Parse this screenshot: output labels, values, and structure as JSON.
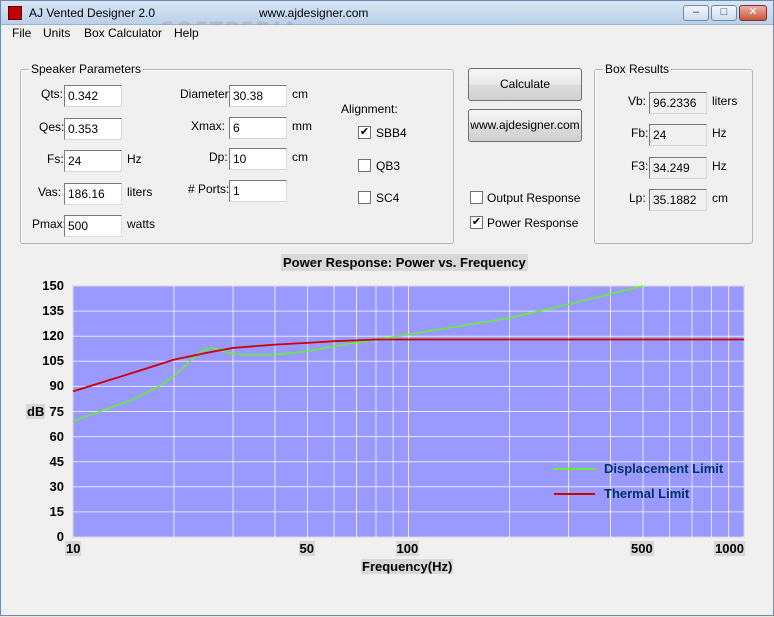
{
  "window": {
    "title": "AJ Vented Designer 2.0",
    "url": "www.ajdesigner.com",
    "watermark": "SOFTPEDIA",
    "controls": {
      "minimize": "–",
      "maximize": "□",
      "close": "✕"
    }
  },
  "menu": [
    "File",
    "Units",
    "Box Calculator",
    "Help"
  ],
  "speaker": {
    "legend": "Speaker Parameters",
    "qts": {
      "label": "Qts:",
      "value": "0.342"
    },
    "qes": {
      "label": "Qes:",
      "value": "0.353"
    },
    "fs": {
      "label": "Fs:",
      "value": "24",
      "unit": "Hz"
    },
    "vas": {
      "label": "Vas:",
      "value": "186.16",
      "unit": "liters"
    },
    "pmax": {
      "label": "Pmax:",
      "value": "500",
      "unit": "watts"
    },
    "diameter": {
      "label": "Diameter:",
      "value": "30.38",
      "unit": "cm"
    },
    "xmax": {
      "label": "Xmax:",
      "value": "6",
      "unit": "mm"
    },
    "dp": {
      "label": "Dp:",
      "value": "10",
      "unit": "cm"
    },
    "ports": {
      "label": "# Ports:",
      "value": "1"
    },
    "alignment": {
      "label": "Alignment:",
      "options": [
        {
          "label": "SBB4",
          "checked": true,
          "mark": "✔"
        },
        {
          "label": "QB3",
          "checked": false,
          "mark": ""
        },
        {
          "label": "SC4",
          "checked": false,
          "mark": ""
        }
      ]
    }
  },
  "buttons": {
    "calculate": "Calculate",
    "website": "www.ajdesigner.com"
  },
  "plot_options": [
    {
      "label": "Output Response",
      "checked": false,
      "mark": ""
    },
    {
      "label": "Power Response",
      "checked": true,
      "mark": "✔"
    }
  ],
  "box_results": {
    "legend": "Box Results",
    "vb": {
      "label": "Vb:",
      "value": "96.2336",
      "unit": "liters"
    },
    "fb": {
      "label": "Fb:",
      "value": "24",
      "unit": "Hz"
    },
    "f3": {
      "label": "F3:",
      "value": "34.249",
      "unit": "Hz"
    },
    "lp": {
      "label": "Lp:",
      "value": "35.1882",
      "unit": "cm"
    }
  },
  "chart_data": {
    "type": "line",
    "title": "Power Response: Power vs. Frequency",
    "xlabel": "Frequency(Hz)",
    "ylabel": "dB",
    "x_scale": "log",
    "xlim": [
      10,
      1000
    ],
    "ylim": [
      0,
      150
    ],
    "x_ticks": [
      "10",
      "50",
      "100",
      "500",
      "1000"
    ],
    "y_ticks": [
      "150",
      "135",
      "120",
      "105",
      "90",
      "75",
      "60",
      "45",
      "30",
      "15",
      "0"
    ],
    "grid": true,
    "legend_position": "bottom-right",
    "plot_bg": "#9999ff",
    "series": [
      {
        "name": "Displacement Limit",
        "color": "#66ee33",
        "points": [
          [
            10,
            69
          ],
          [
            12,
            75
          ],
          [
            15,
            82
          ],
          [
            18,
            90
          ],
          [
            20,
            96
          ],
          [
            22,
            104
          ],
          [
            24,
            111
          ],
          [
            26,
            113
          ],
          [
            28,
            111
          ],
          [
            31,
            109
          ],
          [
            40,
            109
          ],
          [
            50,
            111
          ],
          [
            60,
            114
          ],
          [
            75,
            117
          ],
          [
            100,
            121
          ],
          [
            200,
            131
          ],
          [
            300,
            139
          ],
          [
            500,
            150
          ]
        ]
      },
      {
        "name": "Thermal Limit",
        "color": "#cc0000",
        "points": [
          [
            10,
            87
          ],
          [
            12,
            92
          ],
          [
            15,
            98
          ],
          [
            18,
            103
          ],
          [
            20,
            106
          ],
          [
            25,
            110
          ],
          [
            30,
            113
          ],
          [
            40,
            115
          ],
          [
            50,
            116
          ],
          [
            60,
            117
          ],
          [
            70,
            117.5
          ],
          [
            80,
            118
          ],
          [
            100,
            118
          ],
          [
            1000,
            118
          ]
        ]
      }
    ]
  }
}
